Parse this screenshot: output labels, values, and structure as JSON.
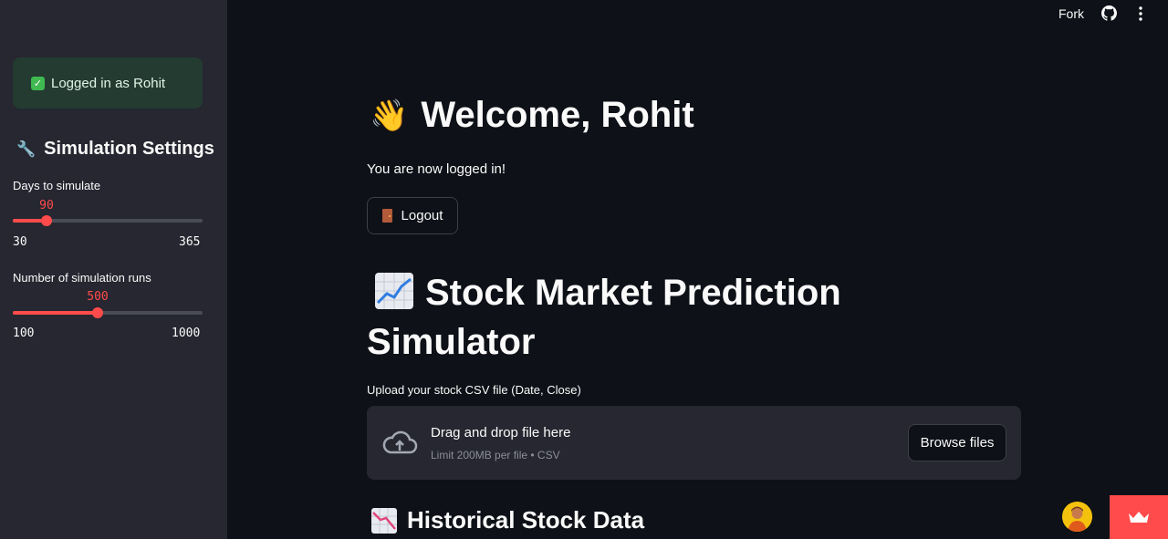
{
  "sidebar": {
    "login_status": "Logged in as Rohit",
    "settings_title": "Simulation Settings",
    "days_slider": {
      "label": "Days to simulate",
      "value": "90",
      "min": "30",
      "max": "365"
    },
    "runs_slider": {
      "label": "Number of simulation runs",
      "value": "500",
      "min": "100",
      "max": "1000"
    }
  },
  "header": {
    "fork_label": "Fork"
  },
  "main": {
    "welcome_title": "Welcome, Rohit",
    "logged_in_text": "You are now logged in!",
    "logout_label": "Logout",
    "app_title": "Stock Market Prediction Simulator",
    "upload": {
      "label": "Upload your stock CSV file (Date, Close)",
      "drag_text": "Drag and drop file here",
      "limit_text": "Limit 200MB per file • CSV",
      "browse_label": "Browse files"
    },
    "historical_title": "Historical Stock Data"
  },
  "colors": {
    "accent": "#ff4b4b",
    "background": "#0e1117",
    "sidebar": "#262730",
    "success_bg": "#233b31"
  }
}
